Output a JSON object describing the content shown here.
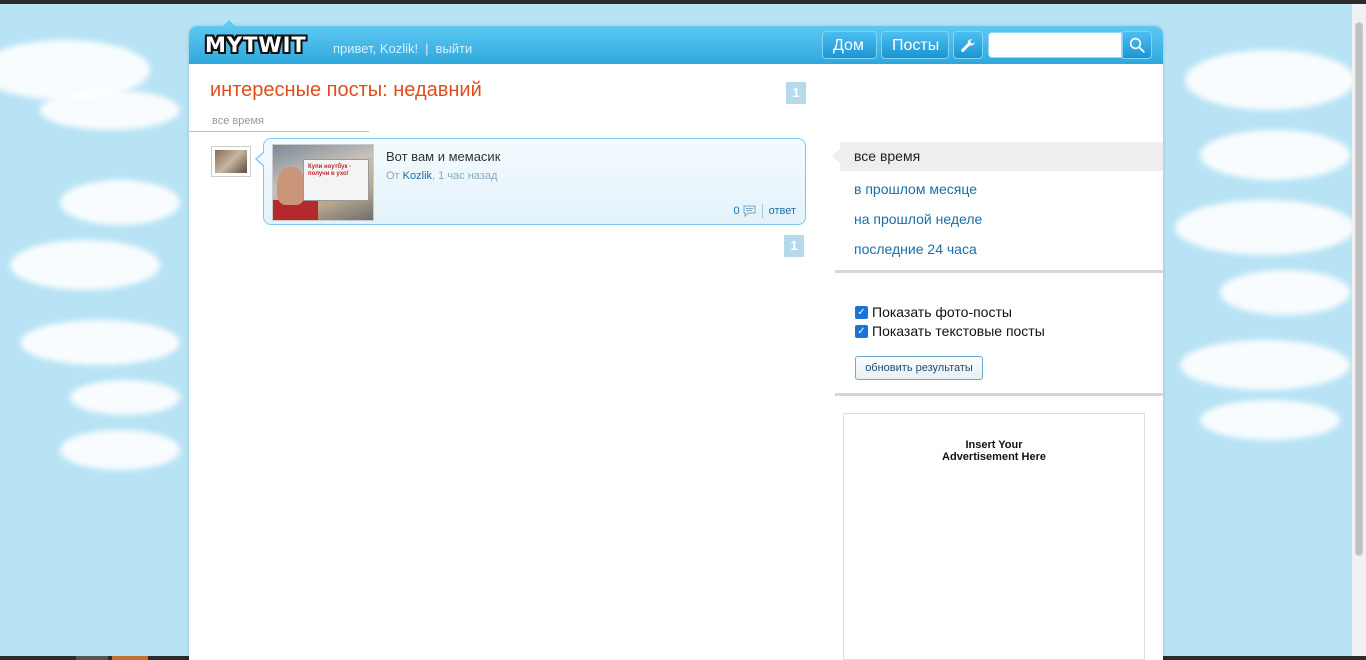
{
  "header": {
    "logo": "MYTWIT",
    "greeting": "привет, Kozlik!",
    "separator": "|",
    "logout": "выйти",
    "nav_home": "Дом",
    "nav_posts": "Посты",
    "search_placeholder": ""
  },
  "main": {
    "title": "интересные посты: недавний",
    "filter_tab": "все время",
    "page_number_top": "1",
    "page_number_bottom": "1",
    "posts": [
      {
        "title": "Вот вам и мемасик",
        "by_label": "От",
        "author": "Kozlik",
        "time": "1 час назад",
        "thumb_text": "Купи ноутбук - получи в ухо!",
        "comments_count": "0",
        "reply_label": "ответ"
      }
    ]
  },
  "sidebar": {
    "active": "все время",
    "links": [
      "в прошлом месяце",
      "на прошлой неделе",
      "последние 24 часа"
    ],
    "checkbox_photo": "Показать фото-посты",
    "checkbox_text": "Показать текстовые посты",
    "refresh_button": "обновить результаты",
    "ad_line1": "Insert Your",
    "ad_line2": "Advertisement Here"
  },
  "colors": {
    "accent": "#2fa8dd",
    "title_red": "#e04d1c",
    "link_blue": "#1a6fa8",
    "sky": "#b8e3f5"
  }
}
